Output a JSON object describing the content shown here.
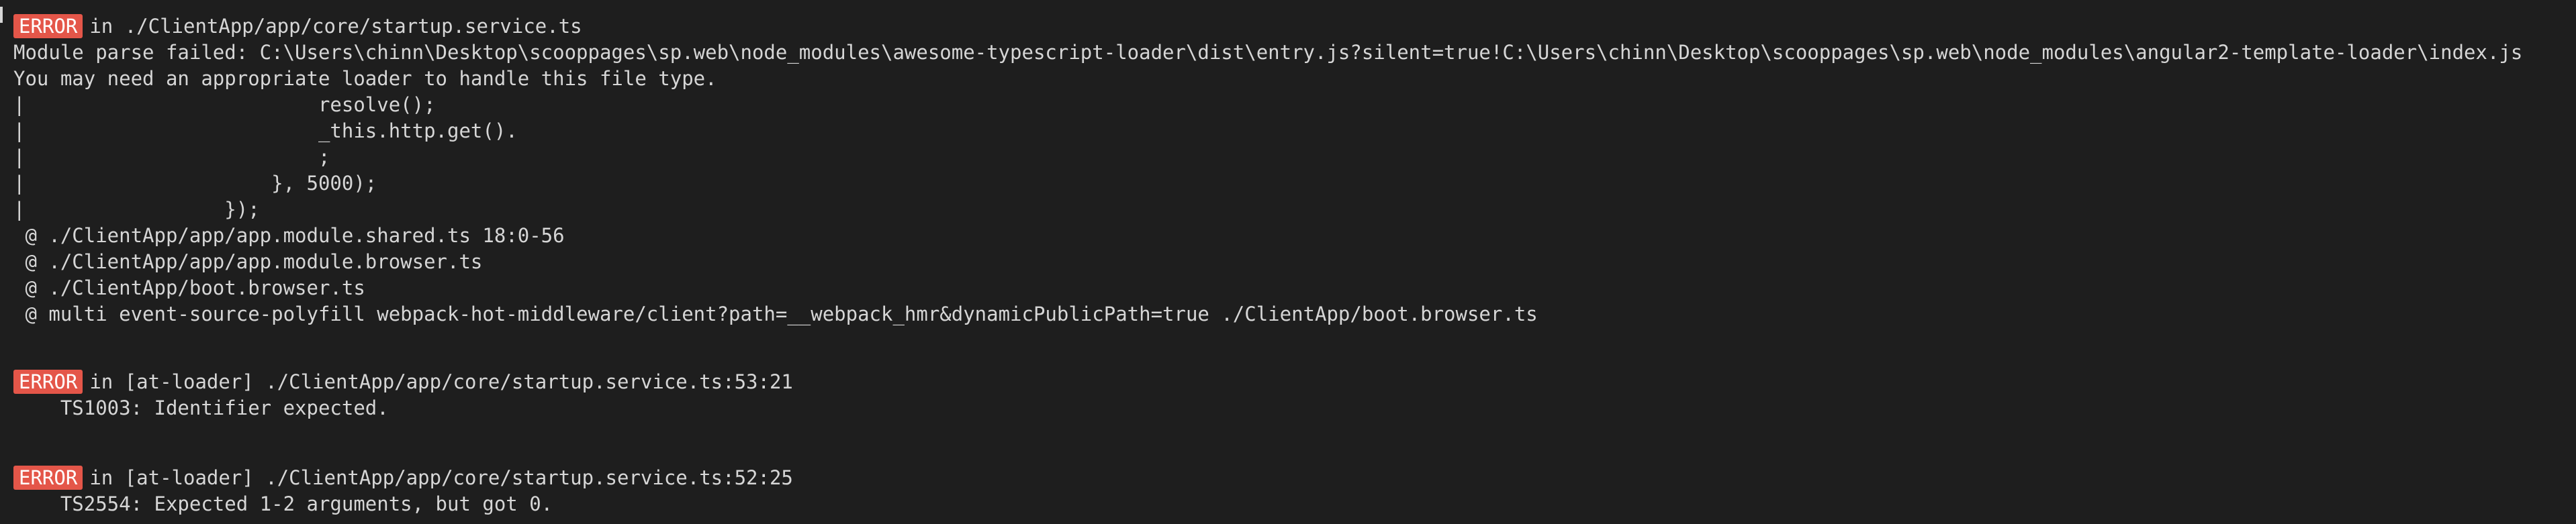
{
  "badge_label": "ERROR",
  "colors": {
    "background": "#1e1e1e",
    "text": "#d6d6d6",
    "badge_bg": "#e45649",
    "badge_text": "#ffffff"
  },
  "error1": {
    "location": "in ./ClientApp/app/core/startup.service.ts",
    "message": "Module parse failed: C:\\Users\\chinn\\Desktop\\scooppages\\sp.web\\node_modules\\awesome-typescript-loader\\dist\\entry.js?silent=true!C:\\Users\\chinn\\Desktop\\scooppages\\sp.web\\node_modules\\angular2-template-loader\\index.js",
    "hint": "You may need an appropriate loader to handle this file type.",
    "code_lines": [
      "|                         resolve();",
      "|                         _this.http.get().",
      "|                         ;",
      "|                     }, 5000);",
      "|                 });"
    ],
    "stack": [
      " @ ./ClientApp/app/app.module.shared.ts 18:0-56",
      " @ ./ClientApp/app/app.module.browser.ts",
      " @ ./ClientApp/boot.browser.ts",
      " @ multi event-source-polyfill webpack-hot-middleware/client?path=__webpack_hmr&dynamicPublicPath=true ./ClientApp/boot.browser.ts"
    ]
  },
  "error2": {
    "location": "in [at-loader] ./ClientApp/app/core/startup.service.ts:53:21",
    "message": "    TS1003: Identifier expected."
  },
  "error3": {
    "location": "in [at-loader] ./ClientApp/app/core/startup.service.ts:52:25",
    "message": "    TS2554: Expected 1-2 arguments, but got 0."
  }
}
